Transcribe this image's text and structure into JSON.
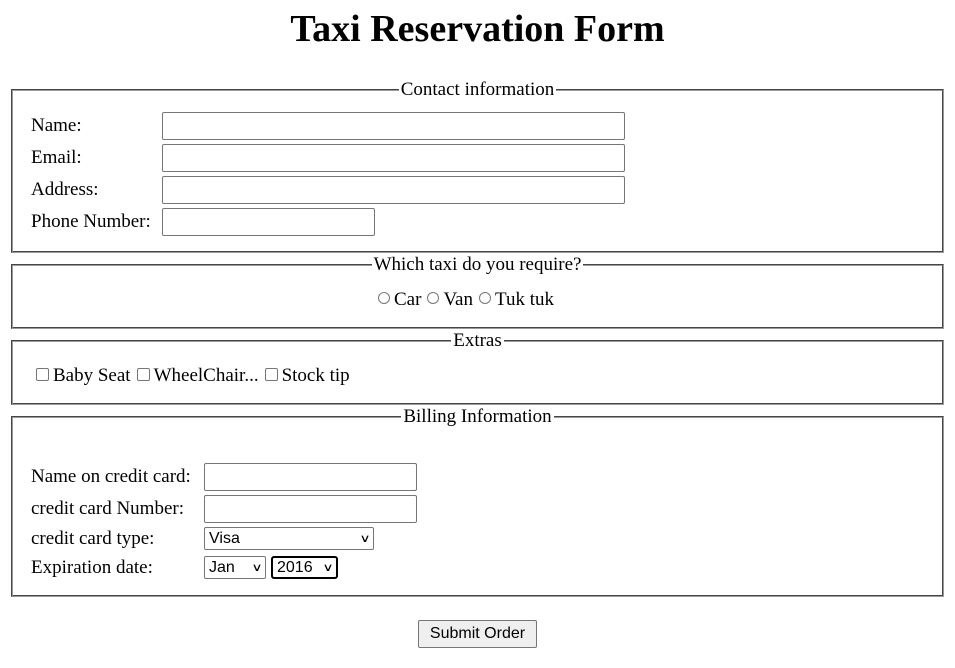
{
  "page": {
    "title": "Taxi Reservation Form"
  },
  "contact": {
    "legend": "Contact information",
    "name_label": "Name:",
    "email_label": "Email:",
    "address_label": "Address:",
    "phone_label": "Phone Number:",
    "name_value": "",
    "email_value": "",
    "address_value": "",
    "phone_value": ""
  },
  "taxi": {
    "legend": "Which taxi do you require?",
    "options": [
      "Car",
      "Van",
      "Tuk tuk"
    ]
  },
  "extras": {
    "legend": "Extras",
    "options": [
      "Baby Seat",
      "WheelChair...",
      "Stock tip"
    ]
  },
  "billing": {
    "legend": "Billing Information",
    "card_name_label": "Name on credit card:",
    "card_number_label": "credit card Number:",
    "card_type_label": "credit card type:",
    "expiration_label": "Expiration date:",
    "card_name_value": "",
    "card_number_value": "",
    "card_type_selected": "Visa",
    "exp_month_selected": "Jan",
    "exp_year_selected": "2016"
  },
  "actions": {
    "submit_label": "Submit Order"
  },
  "colors": {
    "border": "#9a9a9a",
    "input_border": "#767676",
    "button_bg": "#efefef"
  }
}
